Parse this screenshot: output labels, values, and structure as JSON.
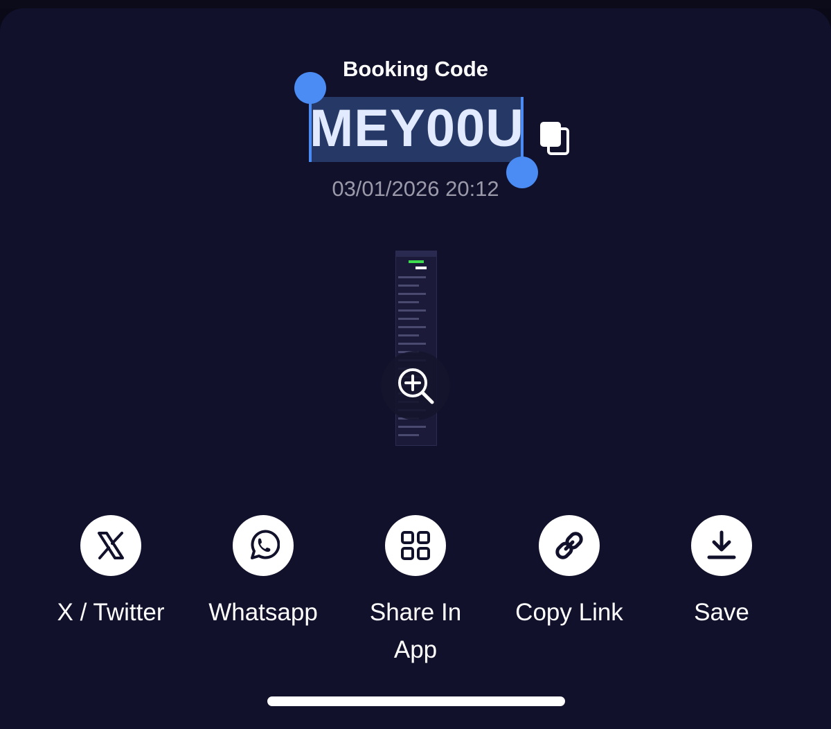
{
  "booking": {
    "title": "Booking Code",
    "code": "MEY00U",
    "datetime": "03/01/2026 20:12"
  },
  "icons": {
    "copy": "copy-icon",
    "zoom": "zoom-in-icon",
    "receipt": "receipt-thumbnail"
  },
  "share_actions": [
    {
      "label": "X / Twitter",
      "icon": "x-twitter-icon"
    },
    {
      "label": "Whatsapp",
      "icon": "whatsapp-icon"
    },
    {
      "label": "Share In App",
      "icon": "grid-apps-icon"
    },
    {
      "label": "Copy Link",
      "icon": "link-icon"
    },
    {
      "label": "Save",
      "icon": "download-icon"
    }
  ],
  "colors": {
    "background": "#12112b",
    "selection": "#263866",
    "selection_handle": "#4a8cf4",
    "text": "#ffffff",
    "muted": "#9a9aab"
  }
}
